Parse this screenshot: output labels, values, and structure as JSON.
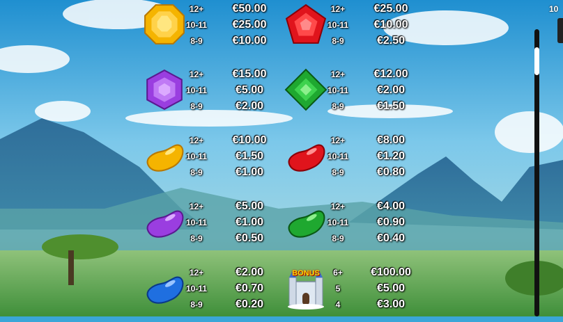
{
  "corner": {
    "text": "10"
  },
  "paytable": [
    {
      "symbol": "yellow-gem-icon",
      "rows": [
        {
          "count": "12+",
          "win": "€50.00"
        },
        {
          "count": "10-11",
          "win": "€25.00"
        },
        {
          "count": "8-9",
          "win": "€10.00"
        }
      ]
    },
    {
      "symbol": "red-gem-icon",
      "rows": [
        {
          "count": "12+",
          "win": "€25.00"
        },
        {
          "count": "10-11",
          "win": "€10.00"
        },
        {
          "count": "8-9",
          "win": "€2.50"
        }
      ]
    },
    {
      "symbol": "purple-gem-icon",
      "rows": [
        {
          "count": "12+",
          "win": "€15.00"
        },
        {
          "count": "10-11",
          "win": "€5.00"
        },
        {
          "count": "8-9",
          "win": "€2.00"
        }
      ]
    },
    {
      "symbol": "green-gem-icon",
      "rows": [
        {
          "count": "12+",
          "win": "€12.00"
        },
        {
          "count": "10-11",
          "win": "€2.00"
        },
        {
          "count": "8-9",
          "win": "€1.50"
        }
      ]
    },
    {
      "symbol": "yellow-jellybean-icon",
      "rows": [
        {
          "count": "12+",
          "win": "€10.00"
        },
        {
          "count": "10-11",
          "win": "€1.50"
        },
        {
          "count": "8-9",
          "win": "€1.00"
        }
      ]
    },
    {
      "symbol": "red-jellybean-icon",
      "rows": [
        {
          "count": "12+",
          "win": "€8.00"
        },
        {
          "count": "10-11",
          "win": "€1.20"
        },
        {
          "count": "8-9",
          "win": "€0.80"
        }
      ]
    },
    {
      "symbol": "purple-jellybean-icon",
      "rows": [
        {
          "count": "12+",
          "win": "€5.00"
        },
        {
          "count": "10-11",
          "win": "€1.00"
        },
        {
          "count": "8-9",
          "win": "€0.50"
        }
      ]
    },
    {
      "symbol": "green-jellybean-icon",
      "rows": [
        {
          "count": "12+",
          "win": "€4.00"
        },
        {
          "count": "10-11",
          "win": "€0.90"
        },
        {
          "count": "8-9",
          "win": "€0.40"
        }
      ]
    },
    {
      "symbol": "blue-jellybean-icon",
      "rows": [
        {
          "count": "12+",
          "win": "€2.00"
        },
        {
          "count": "10-11",
          "win": "€0.70"
        },
        {
          "count": "8-9",
          "win": "€0.20"
        }
      ]
    },
    {
      "symbol": "bonus-castle-icon",
      "label": "BONUS",
      "rows": [
        {
          "count": "6+",
          "win": "€100.00"
        },
        {
          "count": "5",
          "win": "€5.00"
        },
        {
          "count": "4",
          "win": "€3.00"
        }
      ]
    }
  ],
  "colors": {
    "yellow": "#f5b400",
    "red": "#e0141c",
    "purple": "#9a3ee0",
    "green": "#1fa830",
    "blue": "#1f6fe0",
    "sky": "#3aa6d8"
  }
}
